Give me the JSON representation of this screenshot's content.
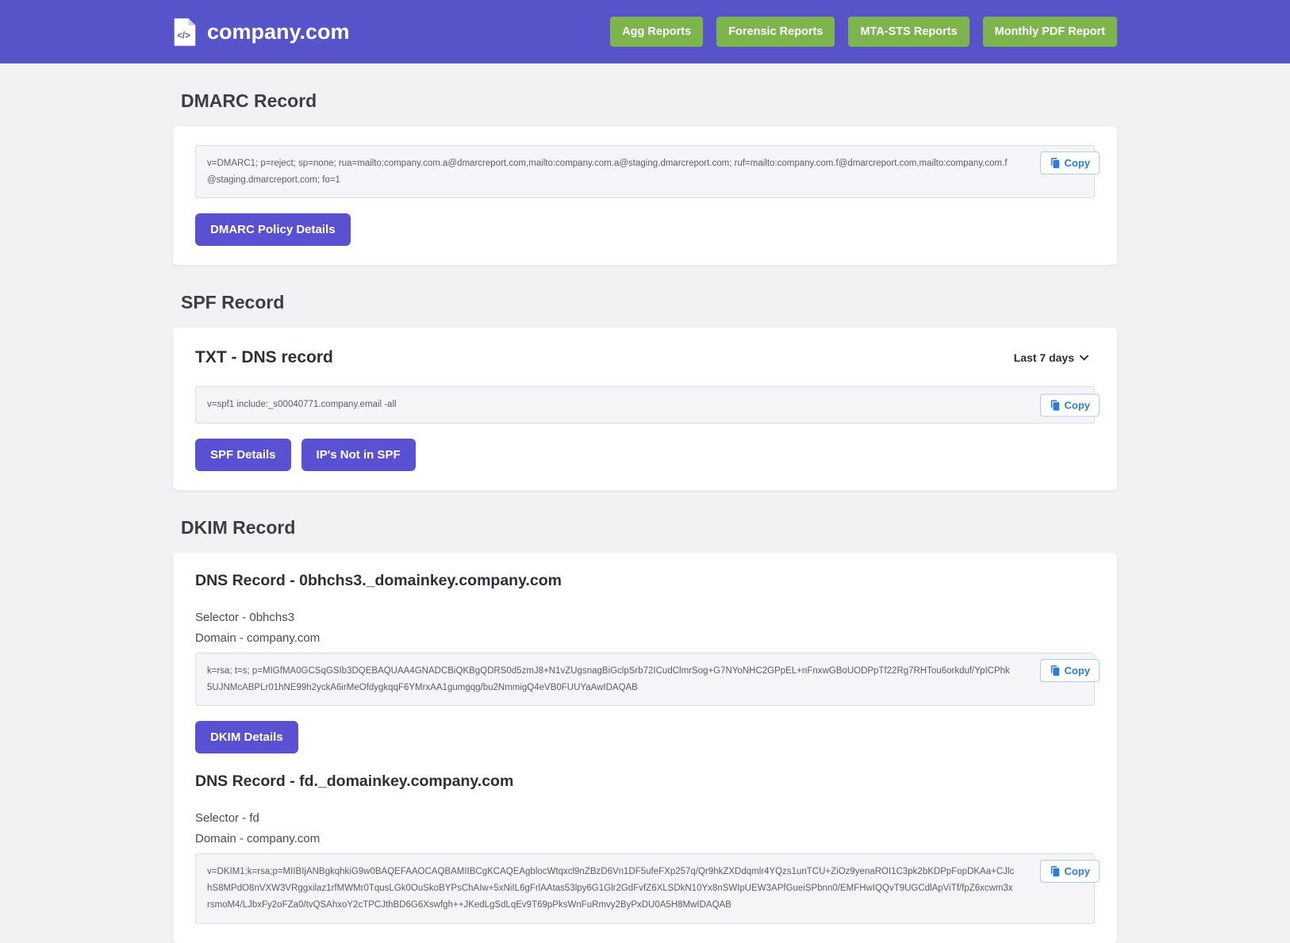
{
  "header": {
    "brand": "company.com",
    "logo_glyph": "</>",
    "nav": [
      {
        "label": "Agg Reports"
      },
      {
        "label": "Forensic Reports"
      },
      {
        "label": "MTA-STS Reports"
      },
      {
        "label": "Monthly PDF Report"
      }
    ]
  },
  "dmarc": {
    "heading": "DMARC Record",
    "record": "v=DMARC1; p=reject; sp=none; rua=mailto:company.com.a@dmarcreport.com,mailto:company.com.a@staging.dmarcreport.com; ruf=mailto:company.com.f@dmarcreport.com,mailto:company.com.f@staging.dmarcreport.com; fo=1",
    "copy_label": "Copy",
    "details_button": "DMARC Policy Details"
  },
  "spf": {
    "heading": "SPF Record",
    "card_title": "TXT - DNS record",
    "period_selected": "Last 7 days",
    "record": "v=spf1 include:_s00040771.company.email -all",
    "copy_label": "Copy",
    "details_button": "SPF Details",
    "ips_button": "IP's Not in SPF"
  },
  "dkim": {
    "heading": "DKIM Record",
    "details_button": "DKIM Details",
    "records": [
      {
        "title": "DNS Record - 0bhchs3._domainkey.company.com",
        "selector_label": "Selector - 0bhchs3",
        "domain_label": "Domain - company.com",
        "record": "k=rsa; t=s; p=MIGfMA0GCSqGSIb3DQEBAQUAA4GNADCBiQKBgQDRS0d5zmJ8+N1vZUgsnagBiGclpSrb72ICudClmrSog+G7NYoNHC2GPpEL+nFnxwGBoUODPpTf22Rg7RHTou6orkduf/YpICPhk5UJNMcABPLr01hNE99h2yckA6irMeOfdygkqqF6YMrxAA1gumgqg/bu2NmmigQ4eVB0FUUYaAwIDAQAB",
        "copy_label": "Copy"
      },
      {
        "title": "DNS Record - fd._domainkey.company.com",
        "selector_label": "Selector - fd",
        "domain_label": "Domain - company.com",
        "record": "v=DKIM1;k=rsa;p=MIIBIjANBgkqhkiG9w0BAQEFAAOCAQBAMIIBCgKCAQEAgblocWtqxcl9nZBzD6Vn1DF5ufeFXp257q/Qr9hkZXDdqmlr4YQzs1unTCU+ZiOz9yenaROI1C3pk2bKDPpFopDKAa+CJlchS8MPdO8nVXW3VRggxilaz1rfMWMr0TqusLGk0OuSkoBYPsChAIw+5xNiIL6gFrlAAtas53lpy6G1Glr2GdFvfZ6XLSDkN10Yx8nSWIpUEW3APfGueiSPbnn0/EMFHwIQQvT9UGCdlApViTf/fpZ6xcwm3xrsmoM4/LJbxFy2oFZa0/tvQSAhxoY2cTPCJthBD6G6Xswfgh++JKedLgSdLqEv9T69pPksWnFuRmvy2ByPxDU0A5H8MwIDAQAB",
        "copy_label": "Copy"
      }
    ]
  },
  "colors": {
    "header_bg": "#5753c8",
    "nav_button": "#7db44c",
    "primary_button": "#5a50d2",
    "copy_accent": "#2e7cd6"
  }
}
